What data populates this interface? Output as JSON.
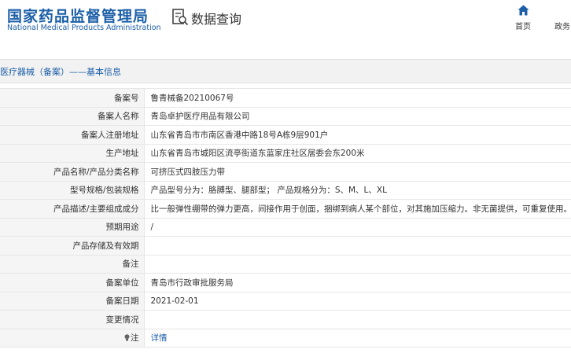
{
  "header": {
    "logo_cn": "国家药品监督管理局",
    "logo_en": "National Medical Products Administration",
    "query_title": "数据查询",
    "nav": {
      "home": "首页",
      "gov": "政务"
    }
  },
  "breadcrumb": "医疗器械（备案）——基本信息",
  "rows": [
    {
      "label": "备案号",
      "value": "鲁青械备20210067号"
    },
    {
      "label": "备案人名称",
      "value": "青岛卓护医疗用品有限公司"
    },
    {
      "label": "备案人注册地址",
      "value": "山东省青岛市市南区香港中路18号A栋9层901户"
    },
    {
      "label": "生产地址",
      "value": "山东省青岛市城阳区流亭街道东蓝家庄社区居委会东200米"
    },
    {
      "label": "产品名称/产品分类名称",
      "value": "可挤压式四肢压力带"
    },
    {
      "label": "型号规格/包装规格",
      "value": "产品型号分为：胳膊型、腿部型；  产品规格分为：S、M、L、XL"
    },
    {
      "label": "产品描述/主要组成成分",
      "value": "比一般弹性绷带的弹力更高，间接作用于创面，捆绑到病人某个部位，对其施加压缩力。非无菌提供，可重复使用。"
    },
    {
      "label": "预期用途",
      "value": "/"
    },
    {
      "label": "产品存储及有效期",
      "value": ""
    },
    {
      "label": "备注",
      "value": ""
    },
    {
      "label": "备案单位",
      "value": "青岛市行政审批服务局"
    },
    {
      "label": "备案日期",
      "value": "2021-02-01"
    },
    {
      "label": "变更情况",
      "value": ""
    },
    {
      "label": "注",
      "value": "详情"
    }
  ],
  "colors": {
    "brand": "#1c5fa8",
    "label_bg": "#f5f5f5",
    "band_bg": "#f2f2f2"
  },
  "icons": [
    "query-icon",
    "home-icon",
    "bulb-icon"
  ]
}
